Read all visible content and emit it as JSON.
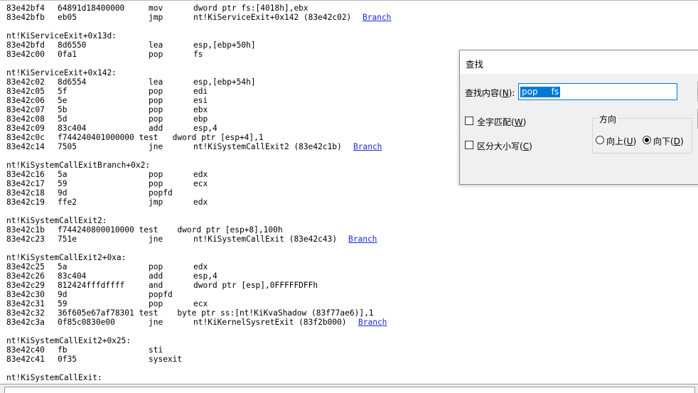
{
  "disassembly": {
    "lines": [
      {
        "kind": "instr",
        "addr": "83e42bf4",
        "bytes": "64891d18400000",
        "mnem": "mov",
        "ops": "dword ptr fs:[4018h],ebx",
        "link": ""
      },
      {
        "kind": "instr",
        "addr": "83e42bfb",
        "bytes": "eb05",
        "mnem": "jmp",
        "ops": "nt!KiServiceExit+0x142 (83e42c02)",
        "link": "Branch"
      },
      {
        "kind": "blank"
      },
      {
        "kind": "label",
        "text": "nt!KiServiceExit+0x13d:"
      },
      {
        "kind": "instr",
        "addr": "83e42bfd",
        "bytes": "8d6550",
        "mnem": "lea",
        "ops": "esp,[ebp+50h]",
        "link": ""
      },
      {
        "kind": "instr",
        "addr": "83e42c00",
        "bytes": "0fa1",
        "mnem": "pop",
        "ops": "fs",
        "link": ""
      },
      {
        "kind": "blank"
      },
      {
        "kind": "label",
        "text": "nt!KiServiceExit+0x142:"
      },
      {
        "kind": "instr",
        "addr": "83e42c02",
        "bytes": "8d6554",
        "mnem": "lea",
        "ops": "esp,[ebp+54h]",
        "link": ""
      },
      {
        "kind": "instr",
        "addr": "83e42c05",
        "bytes": "5f",
        "mnem": "pop",
        "ops": "edi",
        "link": ""
      },
      {
        "kind": "instr",
        "addr": "83e42c06",
        "bytes": "5e",
        "mnem": "pop",
        "ops": "esi",
        "link": ""
      },
      {
        "kind": "instr",
        "addr": "83e42c07",
        "bytes": "5b",
        "mnem": "pop",
        "ops": "ebx",
        "link": ""
      },
      {
        "kind": "instr",
        "addr": "83e42c08",
        "bytes": "5d",
        "mnem": "pop",
        "ops": "ebp",
        "link": ""
      },
      {
        "kind": "instr",
        "addr": "83e42c09",
        "bytes": "83c404",
        "mnem": "add",
        "ops": "esp,4",
        "link": ""
      },
      {
        "kind": "raw",
        "addr": "83e42c0c",
        "text": "f744240401000000 test   dword ptr [esp+4],1",
        "link": ""
      },
      {
        "kind": "instr",
        "addr": "83e42c14",
        "bytes": "7505",
        "mnem": "jne",
        "ops": "nt!KiSystemCallExit2 (83e42c1b)",
        "link": "Branch"
      },
      {
        "kind": "blank"
      },
      {
        "kind": "label",
        "text": "nt!KiSystemCallExitBranch+0x2:"
      },
      {
        "kind": "instr",
        "addr": "83e42c16",
        "bytes": "5a",
        "mnem": "pop",
        "ops": "edx",
        "link": ""
      },
      {
        "kind": "instr",
        "addr": "83e42c17",
        "bytes": "59",
        "mnem": "pop",
        "ops": "ecx",
        "link": ""
      },
      {
        "kind": "instr",
        "addr": "83e42c18",
        "bytes": "9d",
        "mnem": "popfd",
        "ops": "",
        "link": ""
      },
      {
        "kind": "instr",
        "addr": "83e42c19",
        "bytes": "ffe2",
        "mnem": "jmp",
        "ops": "edx",
        "link": ""
      },
      {
        "kind": "blank"
      },
      {
        "kind": "label",
        "text": "nt!KiSystemCallExit2:"
      },
      {
        "kind": "raw",
        "addr": "83e42c1b",
        "text": "f744240800010000 test    dword ptr [esp+8],100h",
        "link": ""
      },
      {
        "kind": "instr",
        "addr": "83e42c23",
        "bytes": "751e",
        "mnem": "jne",
        "ops": "nt!KiSystemCallExit (83e42c43)",
        "link": "Branch"
      },
      {
        "kind": "blank"
      },
      {
        "kind": "label",
        "text": "nt!KiSystemCallExit2+0xa:"
      },
      {
        "kind": "instr",
        "addr": "83e42c25",
        "bytes": "5a",
        "mnem": "pop",
        "ops": "edx",
        "link": ""
      },
      {
        "kind": "instr",
        "addr": "83e42c26",
        "bytes": "83c404",
        "mnem": "add",
        "ops": "esp,4",
        "link": ""
      },
      {
        "kind": "instr",
        "addr": "83e42c29",
        "bytes": "812424fffdffff",
        "mnem": "and",
        "ops": "dword ptr [esp],0FFFFFDFFh",
        "link": ""
      },
      {
        "kind": "instr",
        "addr": "83e42c30",
        "bytes": "9d",
        "mnem": "popfd",
        "ops": "",
        "link": ""
      },
      {
        "kind": "instr",
        "addr": "83e42c31",
        "bytes": "59",
        "mnem": "pop",
        "ops": "ecx",
        "link": ""
      },
      {
        "kind": "raw",
        "addr": "83e42c32",
        "text": "36f605e67af78301 test    byte ptr ss:[nt!KiKvaShadow (83f77ae6)],1",
        "link": ""
      },
      {
        "kind": "instr",
        "addr": "83e42c3a",
        "bytes": "0f85c0830e00",
        "mnem": "jne",
        "ops": "nt!KiKernelSysretExit (83f2b000)",
        "link": "Branch"
      },
      {
        "kind": "blank"
      },
      {
        "kind": "label",
        "text": "nt!KiSystemCallExit2+0x25:"
      },
      {
        "kind": "instr",
        "addr": "83e42c40",
        "bytes": "fb",
        "mnem": "sti",
        "ops": "",
        "link": ""
      },
      {
        "kind": "instr",
        "addr": "83e42c41",
        "bytes": "0f35",
        "mnem": "sysexit",
        "ops": "",
        "link": ""
      },
      {
        "kind": "blank"
      },
      {
        "kind": "label",
        "text": "nt!KiSystemCallExit:"
      }
    ]
  },
  "find_dialog": {
    "title": "查找",
    "find_what_label": "查找内容(N):",
    "find_what_value": "pop     fs",
    "whole_word_label": "全字匹配(W)",
    "whole_word_checked": false,
    "match_case_label": "区分大小写(C)",
    "match_case_checked": false,
    "direction_title": "方向",
    "direction_up_label": "向上(U)",
    "direction_down_label": "向下(D)",
    "direction_selected": "down"
  },
  "colors": {
    "link": "#1a2ad8",
    "selection": "#0078d7",
    "dialog_bg": "#f0f0f0"
  }
}
